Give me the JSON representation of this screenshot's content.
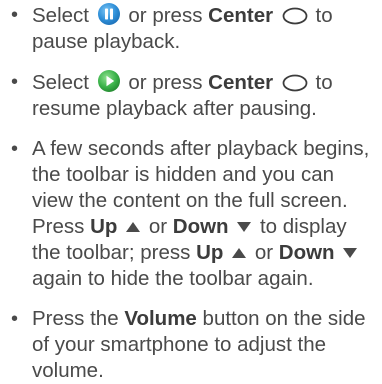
{
  "bullets": [
    {
      "select": "Select",
      "or_press": "or press",
      "center": "Center",
      "to": "to",
      "tail": "pause playback.",
      "icon": "pause-icon",
      "icon_color": "#2f8fd8"
    },
    {
      "select": "Select",
      "or_press": "or press",
      "center": "Center",
      "to": "to",
      "tail": "resume playback after pausing.",
      "icon": "play-icon",
      "icon_color": "#3bb34a"
    },
    {
      "lead": "A few seconds after playback begins, the toolbar is hidden and you can view the content on the full screen. Press",
      "up": "Up",
      "or": "or",
      "down": "Down",
      "middle": "to display the toolbar; press",
      "up2": "Up",
      "or2": "or",
      "down2": "Down",
      "tail": "again to hide the toolbar again."
    },
    {
      "lead": "Press the",
      "volume": "Volume",
      "tail": "button on the side of your smartphone to adjust the volume."
    }
  ],
  "colors": {
    "text": "#4a4a4a",
    "arrow": "#4a4a4a",
    "pause_icon": "#2f8fd8",
    "play_icon": "#3bb34a"
  }
}
